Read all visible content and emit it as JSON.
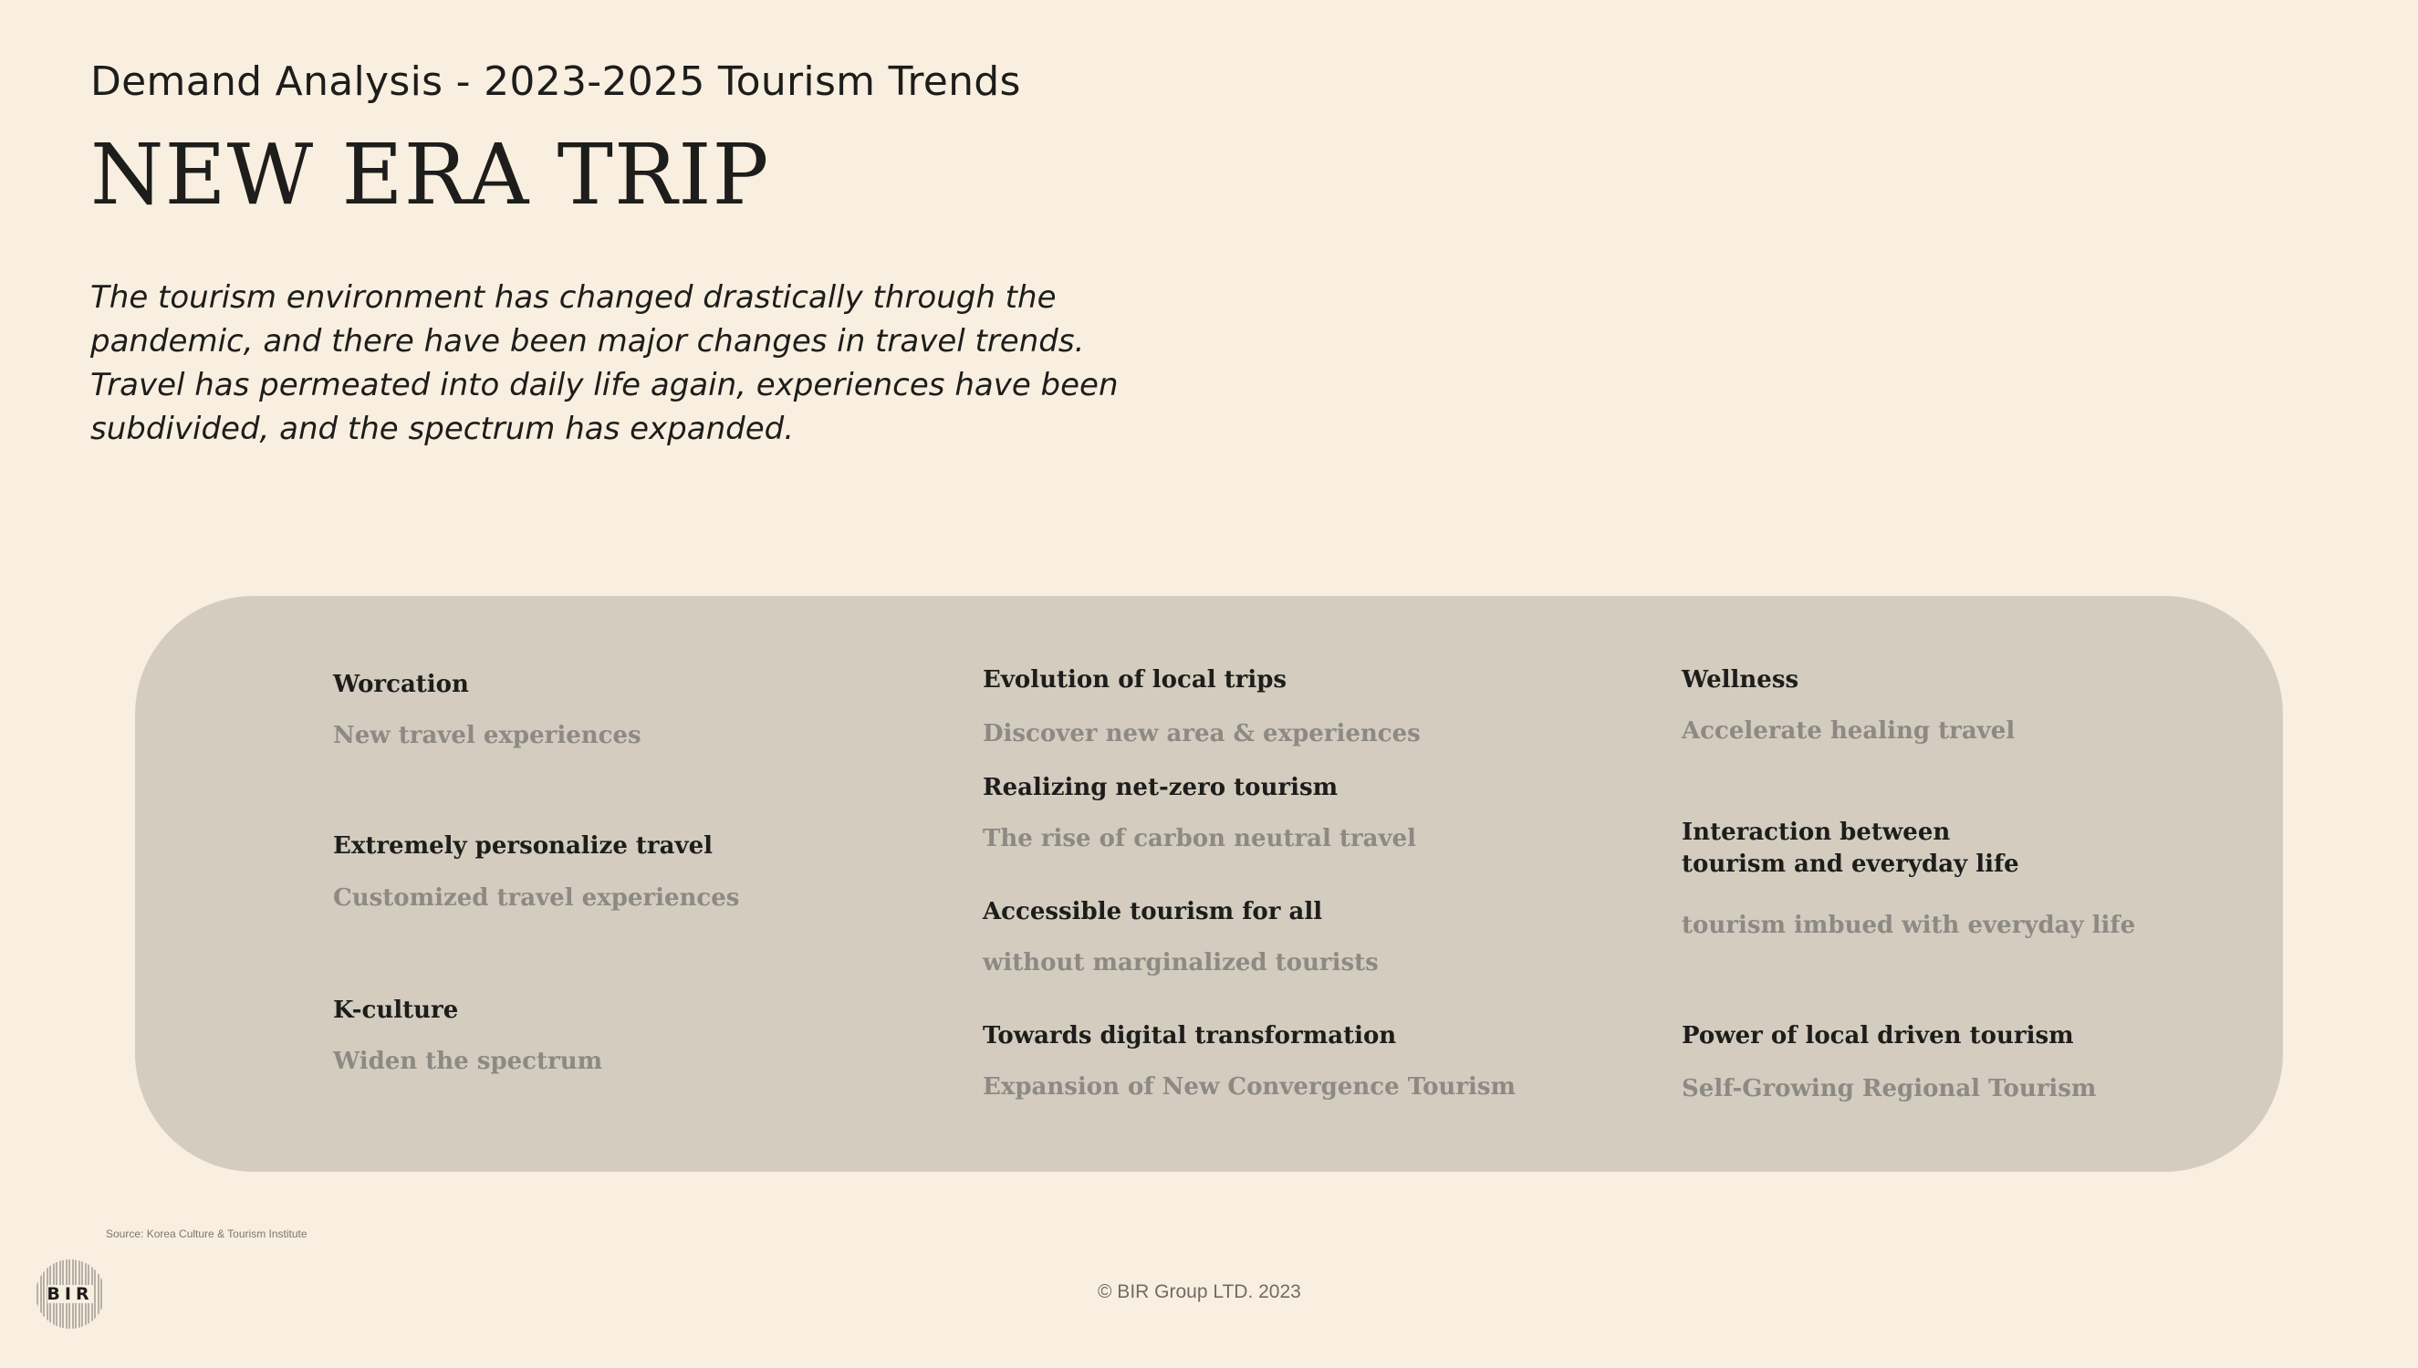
{
  "header": {
    "subtitle": "Demand Analysis - 2023-2025 Tourism Trends",
    "title": "NEW ERA TRIP",
    "intro_lines": [
      "The tourism environment has changed drastically through the",
      "pandemic, and there have been major changes in travel trends.",
      "Travel has permeated into daily life again, experiences have been",
      "subdivided, and the spectrum has expanded."
    ]
  },
  "trends": {
    "col1": [
      {
        "title": "Worcation",
        "desc": "New travel experiences"
      },
      {
        "title": "Extremely personalize travel",
        "desc": "Customized travel experiences"
      },
      {
        "title": "K-culture",
        "desc": "Widen the spectrum"
      }
    ],
    "col2": [
      {
        "title": "Evolution of local trips",
        "desc": "Discover new area & experiences"
      },
      {
        "title": "Realizing net-zero tourism",
        "desc": "The rise of carbon neutral travel"
      },
      {
        "title": "Accessible tourism for all",
        "desc": "without marginalized tourists"
      },
      {
        "title": "Towards digital transformation",
        "desc": "Expansion of New Convergence Tourism"
      }
    ],
    "col3": [
      {
        "title": "Wellness",
        "desc": "Accelerate healing travel"
      },
      {
        "title_lines": [
          "Interaction between",
          "tourism and everyday life"
        ],
        "desc": "tourism imbued with everyday life"
      },
      {
        "title": "Power of local driven tourism",
        "desc": "Self-Growing Regional Tourism"
      }
    ]
  },
  "footer": {
    "source": "Source: Korea Culture & Tourism Institute",
    "logo_text": "BIR",
    "copyright": "© BIR Group LTD. 2023"
  },
  "colors": {
    "background": "#f9efe0",
    "panel": "#d3ccbf",
    "title_text": "#1d1d1b",
    "muted_text": "#8d8a84"
  }
}
